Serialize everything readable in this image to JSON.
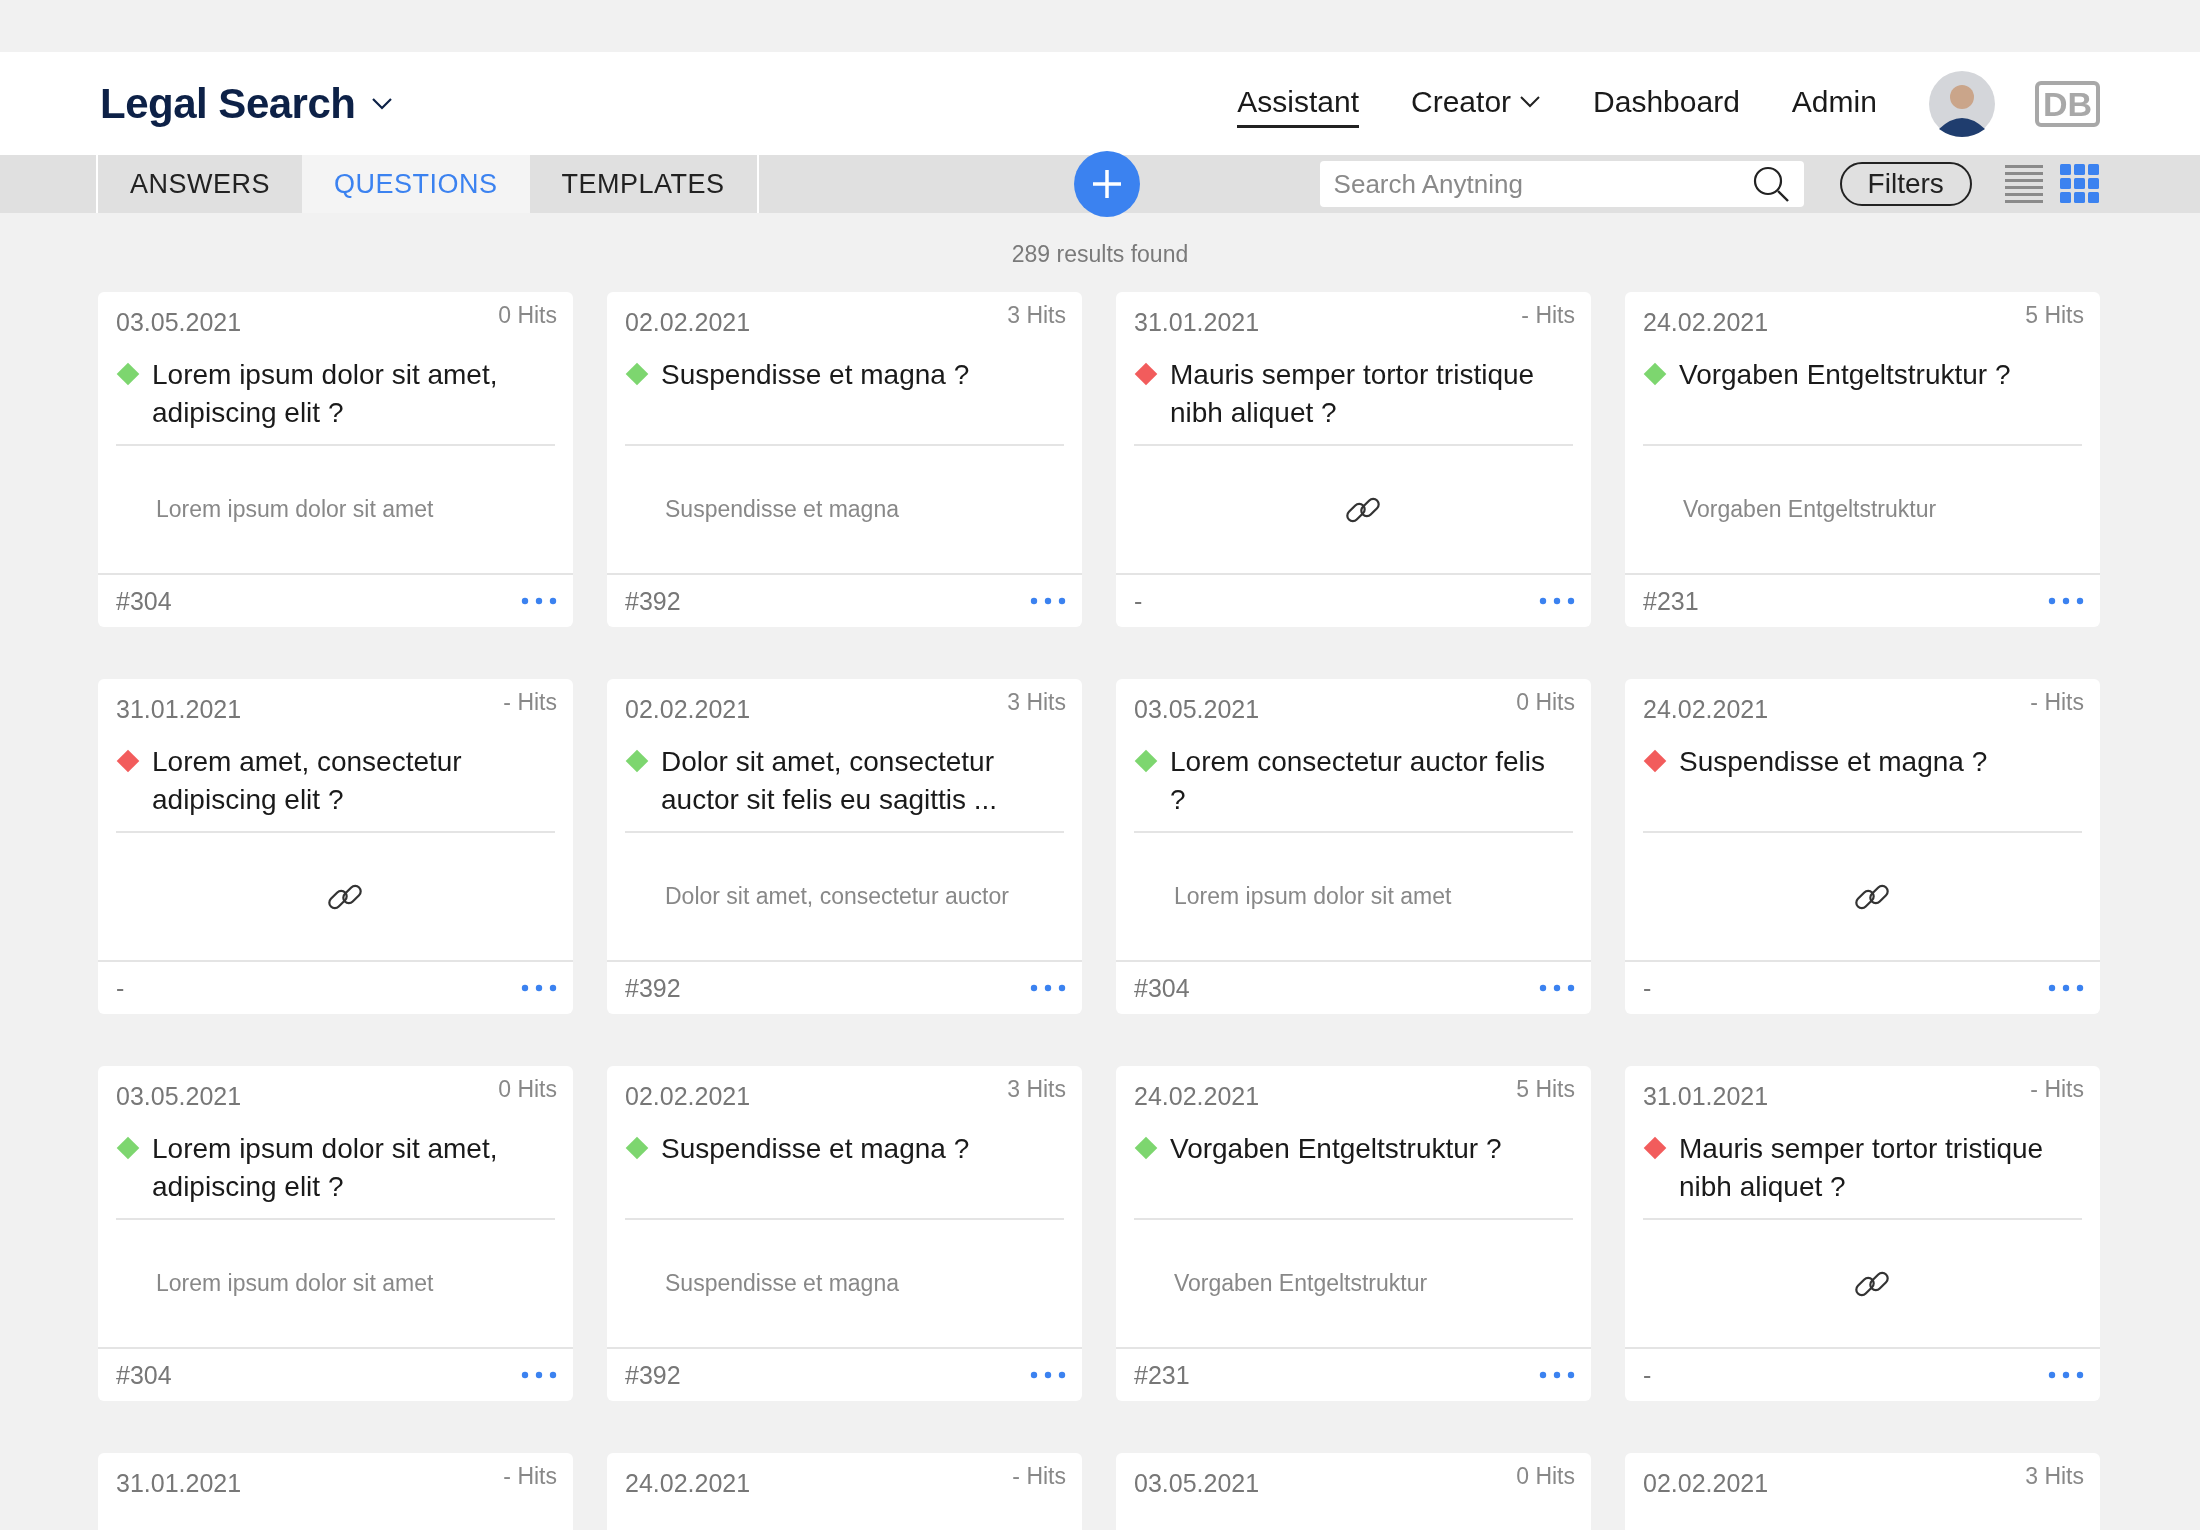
{
  "app_title": "Legal Search",
  "nav": [
    {
      "label": "Assistant",
      "selected": true,
      "dropdown": false
    },
    {
      "label": "Creator",
      "selected": false,
      "dropdown": true
    },
    {
      "label": "Dashboard",
      "selected": false,
      "dropdown": false
    },
    {
      "label": "Admin",
      "selected": false,
      "dropdown": false
    }
  ],
  "logo": "DB",
  "tabs": [
    {
      "label": "ANSWERS",
      "selected": false
    },
    {
      "label": "QUESTIONS",
      "selected": true
    },
    {
      "label": "TEMPLATES",
      "selected": false
    }
  ],
  "search": {
    "placeholder": "Search Anytning"
  },
  "filters_button": "Filters",
  "views": [
    {
      "kind": "list",
      "selected": false
    },
    {
      "kind": "grid",
      "selected": true
    }
  ],
  "results": "289 results found",
  "cards": [
    {
      "date": "03.05.2021",
      "hits": "0 Hits",
      "color": "#7dd66f",
      "question": "Lorem ipsum dolor sit amet, adipiscing elit ?",
      "kind": "text",
      "snippet": "Lorem ipsum dolor sit amet",
      "id": "#304"
    },
    {
      "date": "02.02.2021",
      "hits": "3 Hits",
      "color": "#7dd66f",
      "question": "Suspendisse et magna ?",
      "kind": "text",
      "snippet": "Suspendisse et magna",
      "id": "#392"
    },
    {
      "date": "31.01.2021",
      "hits": "- Hits",
      "color": "#f25c5c",
      "question": "Mauris semper tortor tristique nibh aliquet ?",
      "kind": "link",
      "id": "-"
    },
    {
      "date": "24.02.2021",
      "hits": "5 Hits",
      "color": "#7dd66f",
      "question": "Vorgaben Entgeltstruktur ?",
      "kind": "text",
      "snippet": "Vorgaben Entgeltstruktur",
      "id": "#231"
    },
    {
      "date": "31.01.2021",
      "hits": "- Hits",
      "color": "#f25c5c",
      "question": "Lorem amet, consectetur adipiscing elit ?",
      "kind": "link",
      "id": "-"
    },
    {
      "date": "02.02.2021",
      "hits": "3 Hits",
      "color": "#7dd66f",
      "question": "Dolor sit amet, consectetur auctor sit felis eu sagittis ...",
      "kind": "text",
      "snippet": "Dolor sit amet, consectetur auctor",
      "id": "#392"
    },
    {
      "date": "03.05.2021",
      "hits": "0 Hits",
      "color": "#7dd66f",
      "question": "Lorem consectetur auctor felis ?",
      "kind": "text",
      "snippet": "Lorem ipsum dolor sit amet",
      "id": "#304"
    },
    {
      "date": "24.02.2021",
      "hits": "- Hits",
      "color": "#f25c5c",
      "question": "Suspendisse et magna ?",
      "kind": "link",
      "id": "-"
    },
    {
      "date": "03.05.2021",
      "hits": "0 Hits",
      "color": "#7dd66f",
      "question": "Lorem ipsum dolor sit amet, adipiscing elit ?",
      "kind": "text",
      "snippet": "Lorem ipsum dolor sit amet",
      "id": "#304"
    },
    {
      "date": "02.02.2021",
      "hits": "3 Hits",
      "color": "#7dd66f",
      "question": "Suspendisse et magna ?",
      "kind": "text",
      "snippet": "Suspendisse et magna",
      "id": "#392"
    },
    {
      "date": "24.02.2021",
      "hits": "5 Hits",
      "color": "#7dd66f",
      "question": "Vorgaben Entgeltstruktur ?",
      "kind": "text",
      "snippet": "Vorgaben Entgeltstruktur",
      "id": "#231"
    },
    {
      "date": "31.01.2021",
      "hits": "- Hits",
      "color": "#f25c5c",
      "question": "Mauris semper tortor tristique nibh aliquet ?",
      "kind": "link",
      "id": "-"
    },
    {
      "date": "31.01.2021",
      "hits": "- Hits"
    },
    {
      "date": "24.02.2021",
      "hits": "- Hits"
    },
    {
      "date": "03.05.2021",
      "hits": "0 Hits"
    },
    {
      "date": "02.02.2021",
      "hits": "3 Hits"
    }
  ]
}
